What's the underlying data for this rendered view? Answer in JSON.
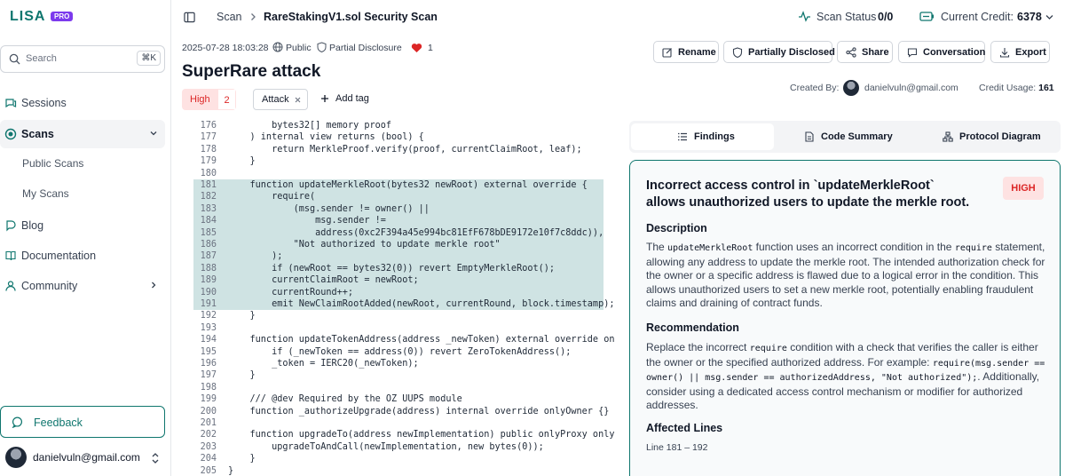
{
  "app": {
    "logo": "LISA",
    "badge": "PRO"
  },
  "sidebar": {
    "search": {
      "placeholder": "Search",
      "shortcut": "⌘K"
    },
    "items": [
      {
        "label": "Sessions",
        "icon": "sessions-icon"
      },
      {
        "label": "Scans",
        "icon": "scans-icon",
        "expanded": true
      },
      {
        "label": "Blog",
        "icon": "blog-icon"
      },
      {
        "label": "Documentation",
        "icon": "book-icon"
      },
      {
        "label": "Community",
        "icon": "community-icon"
      }
    ],
    "sub_items": [
      "Public Scans",
      "My Scans"
    ],
    "feedback": "Feedback",
    "user_email": "danielvuln@gmail.com"
  },
  "breadcrumb": {
    "root": "Scan",
    "current": "RareStakingV1.sol Security Scan"
  },
  "status": {
    "scan_label": "Scan Status",
    "scan_value": "0/0",
    "credit_label": "Current Credit:",
    "credit_value": "6378"
  },
  "scan": {
    "date": "2025-07-28 18:03:28",
    "visibility": "Public",
    "disclosure": "Partial Disclosure",
    "likes": "1",
    "title": "SuperRare attack",
    "severity": "High",
    "severity_count": "2",
    "tag": "Attack",
    "add_tag": "Add tag",
    "created_by_label": "Created By:",
    "created_by": "danielvuln@gmail.com",
    "credit_usage_label": "Credit Usage:",
    "credit_usage": "161"
  },
  "actions": [
    "Rename",
    "Partially Disclosed",
    "Share",
    "Conversation",
    "Export"
  ],
  "tabs": [
    "Findings",
    "Code Summary",
    "Protocol Diagram"
  ],
  "code": [
    {
      "n": "176",
      "t": "        bytes32[] memory proof"
    },
    {
      "n": "177",
      "t": "    ) internal view returns (bool) {"
    },
    {
      "n": "178",
      "t": "        return MerkleProof.verify(proof, currentClaimRoot, leaf);"
    },
    {
      "n": "179",
      "t": "    }"
    },
    {
      "n": "180",
      "t": ""
    },
    {
      "n": "181",
      "t": "    function updateMerkleRoot(bytes32 newRoot) external override {"
    },
    {
      "n": "182",
      "t": "        require("
    },
    {
      "n": "183",
      "t": "            (msg.sender != owner() ||"
    },
    {
      "n": "184",
      "t": "                msg.sender !="
    },
    {
      "n": "185",
      "t": "                address(0xc2F394a45e994bc81EfF678bDE9172e10f7c8ddc)),"
    },
    {
      "n": "186",
      "t": "            \"Not authorized to update merkle root\""
    },
    {
      "n": "187",
      "t": "        );"
    },
    {
      "n": "188",
      "t": "        if (newRoot == bytes32(0)) revert EmptyMerkleRoot();"
    },
    {
      "n": "189",
      "t": "        currentClaimRoot = newRoot;"
    },
    {
      "n": "190",
      "t": "        currentRound++;"
    },
    {
      "n": "191",
      "t": "        emit NewClaimRootAdded(newRoot, currentRound, block.timestamp);"
    },
    {
      "n": "192",
      "t": "    }"
    },
    {
      "n": "193",
      "t": ""
    },
    {
      "n": "194",
      "t": "    function updateTokenAddress(address _newToken) external override onlyOwne"
    },
    {
      "n": "195",
      "t": "        if (_newToken == address(0)) revert ZeroTokenAddress();"
    },
    {
      "n": "196",
      "t": "        _token = IERC20(_newToken);"
    },
    {
      "n": "197",
      "t": "    }"
    },
    {
      "n": "198",
      "t": ""
    },
    {
      "n": "199",
      "t": "    /// @dev Required by the OZ UUPS module"
    },
    {
      "n": "200",
      "t": "    function _authorizeUpgrade(address) internal override onlyOwner {}"
    },
    {
      "n": "201",
      "t": ""
    },
    {
      "n": "202",
      "t": "    function upgradeTo(address newImplementation) public onlyProxy onlyOwner"
    },
    {
      "n": "203",
      "t": "        upgradeToAndCall(newImplementation, new bytes(0));"
    },
    {
      "n": "204",
      "t": "    }"
    },
    {
      "n": "205",
      "t": "}"
    }
  ],
  "highlight_range": [
    181,
    191
  ],
  "finding": {
    "title": "Incorrect access control in `updateMerkleRoot` allows unauthorized users to update the merkle root.",
    "severity": "HIGH",
    "description_heading": "Description",
    "description_pre": "The ",
    "description_code1": "updateMerkleRoot",
    "description_mid": " function uses an incorrect condition in the ",
    "description_code2": "require",
    "description_post": " statement, allowing any address to update the merkle root. The intended authorization check for the owner or a specific address is flawed due to a logical error in the condition. This allows unauthorized users to set a new merkle root, potentially enabling fraudulent claims and draining of contract funds.",
    "recommendation_heading": "Recommendation",
    "recommendation_pre": "Replace the incorrect ",
    "recommendation_code1": "require",
    "recommendation_mid": " condition with a check that verifies the caller is either the owner or the specified authorized address. For example: ",
    "recommendation_code2": "require(msg.sender == owner() || msg.sender == authorizedAddress, \"Not authorized\");",
    "recommendation_post": ". Additionally, consider using a dedicated access control mechanism or modifier for authorized addresses.",
    "affected_heading": "Affected Lines",
    "affected_lines": "Line 181 – 192"
  },
  "colors": {
    "accent": "#0f766e",
    "high": "#dc2626",
    "high_bg": "#fee2e2",
    "highlight": "#cfe3e3"
  }
}
